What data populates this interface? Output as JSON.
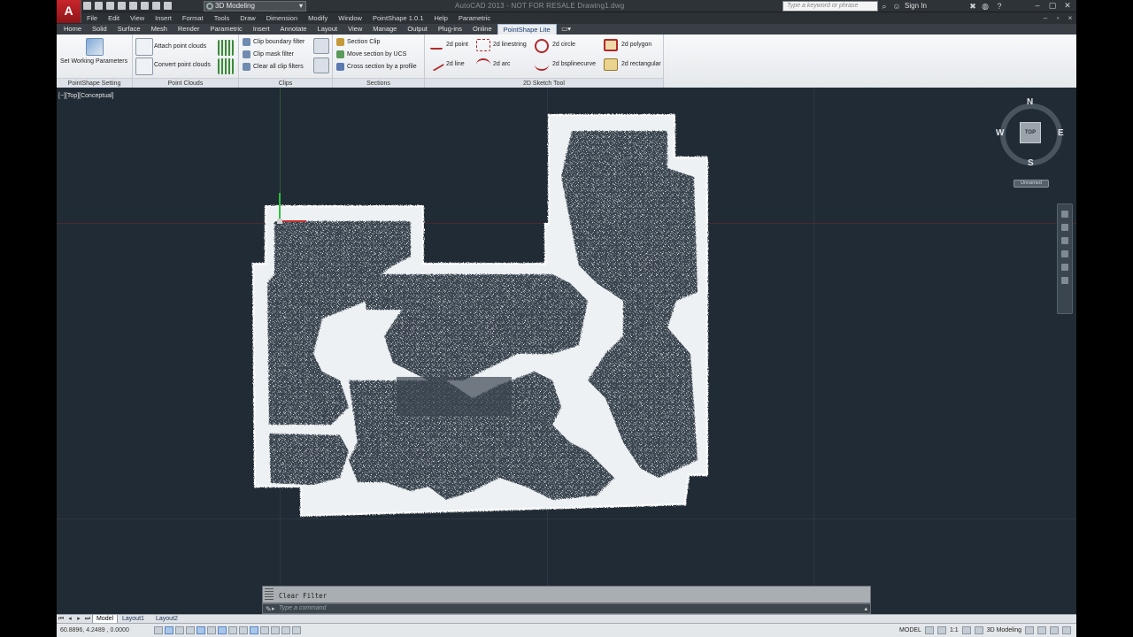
{
  "titlebar": {
    "app_letter": "A",
    "workspace": "3D Modeling",
    "title": "AutoCAD 2013 - NOT FOR RESALE    Drawing1.dwg",
    "search_placeholder": "Type a keyword or phrase",
    "sign_in": "Sign In"
  },
  "menu": {
    "items": [
      "File",
      "Edit",
      "View",
      "Insert",
      "Format",
      "Tools",
      "Draw",
      "Dimension",
      "Modify",
      "Window",
      "PointShape 1.0.1",
      "Help",
      "Parametric"
    ]
  },
  "ribbon_tabs": {
    "items": [
      "Home",
      "Solid",
      "Surface",
      "Mesh",
      "Render",
      "Parametric",
      "Insert",
      "Annotate",
      "Layout",
      "View",
      "Manage",
      "Output",
      "Plug-ins",
      "Online",
      "PointShape Lite"
    ],
    "active": "PointShape Lite"
  },
  "ribbon": {
    "setting": {
      "button": "Set Working Parameters",
      "title": "PointShape Setting"
    },
    "point_clouds": {
      "attach": "Attach point clouds",
      "convert": "Convert point clouds",
      "title": "Point Clouds"
    },
    "clips": {
      "boundary": "Clip boundary filter",
      "mask": "Clip mask filter",
      "clear": "Clear all clip filters",
      "title": "Clips"
    },
    "sections": {
      "clip": "Section Clip",
      "move": "Move section by UCS",
      "cross": "Cross section by a profile",
      "title": "Sections"
    },
    "sketch": {
      "point": "2d point",
      "line": "2d line",
      "linestring": "2d linestring",
      "arc": "2d arc",
      "circle": "2d circle",
      "bspline": "2d bsplinecurve",
      "polygon": "2d polygon",
      "rectangular": "2d rectangular",
      "title": "2D Sketch Tool"
    }
  },
  "viewport": {
    "label": "[−][Top][Conceptual]",
    "viewcube": {
      "face": "TOP",
      "n": "N",
      "s": "S",
      "e": "E",
      "w": "W"
    },
    "ucs": "Unnamed"
  },
  "command": {
    "history": "Clear Filter",
    "placeholder": "Type a command"
  },
  "layout_tabs": {
    "items": [
      "Model",
      "Layout1",
      "Layout2"
    ],
    "active": "Model"
  },
  "status": {
    "coords": "60.8896, 4.2489 , 0.0000",
    "model": "MODEL",
    "scale": "1:1",
    "workspace": "3D Modeling"
  },
  "colors": {
    "background": "#212b35",
    "point_cloud": "#f2f2f2",
    "accent_tab": "#1a3f75"
  }
}
